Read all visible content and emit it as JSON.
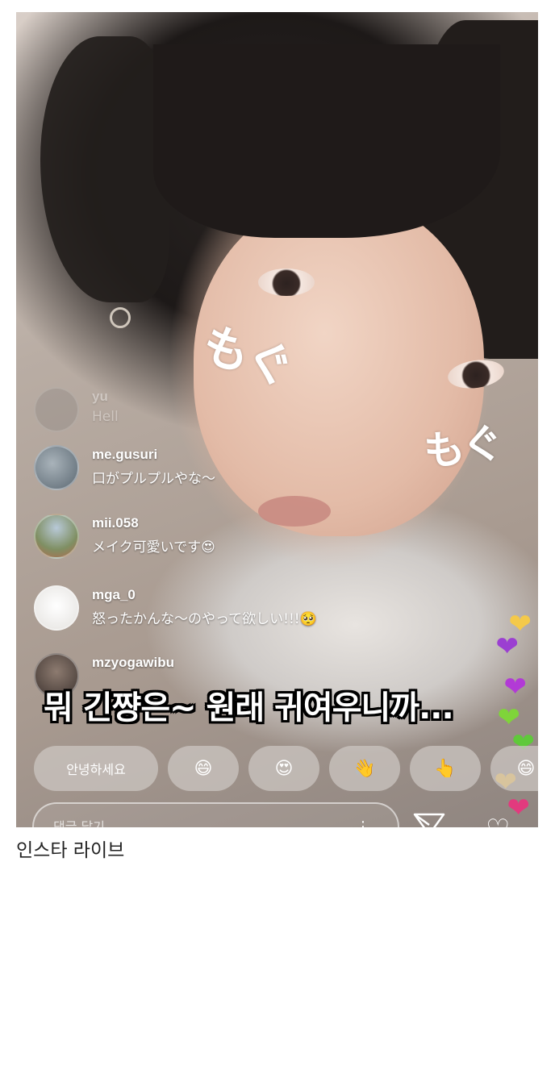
{
  "stickers": [
    "もぐ",
    "もぐ"
  ],
  "comments": [
    {
      "user": "yu",
      "text": "Hell"
    },
    {
      "user": "me.gusuri",
      "text": "口がプルプルやな〜",
      "avatar_color": "#6b7a86"
    },
    {
      "user": "mii.058",
      "text": "メイク可愛いです😍",
      "avatar_color": "#7a8f6f"
    },
    {
      "user": "mga_0",
      "text": "怒ったかんな〜のやって欲しい!!!🥺",
      "avatar_color": "#e9e7e4"
    },
    {
      "user": "mzyogawibu",
      "text": "",
      "avatar_color": "#5a4e48"
    }
  ],
  "subtitle": "뭐 긴쨩은~ 원래 귀여우니까...",
  "quick_replies": {
    "greeting": "안녕하세요",
    "e1": "😄",
    "e2": "😍",
    "e3": "👋",
    "e4": "👆",
    "e5": "😄"
  },
  "input": {
    "placeholder": "댓글 달기"
  },
  "icons": {
    "send": "send-icon",
    "like": "heart-icon",
    "more": "more-dots-icon"
  },
  "hearts": [
    {
      "color": "#f4c94a",
      "glyph": "❤"
    },
    {
      "color": "#9b3fd1",
      "glyph": "❤"
    },
    {
      "color": "#b23ad6",
      "glyph": "❤"
    },
    {
      "color": "#7fd43a",
      "glyph": "❤"
    },
    {
      "color": "#5fc93a",
      "glyph": "❤"
    },
    {
      "color": "#f2b93b",
      "glyph": "❤"
    },
    {
      "color": "#e23a7e",
      "glyph": "❤"
    }
  ],
  "caption": "인스타 라이브"
}
